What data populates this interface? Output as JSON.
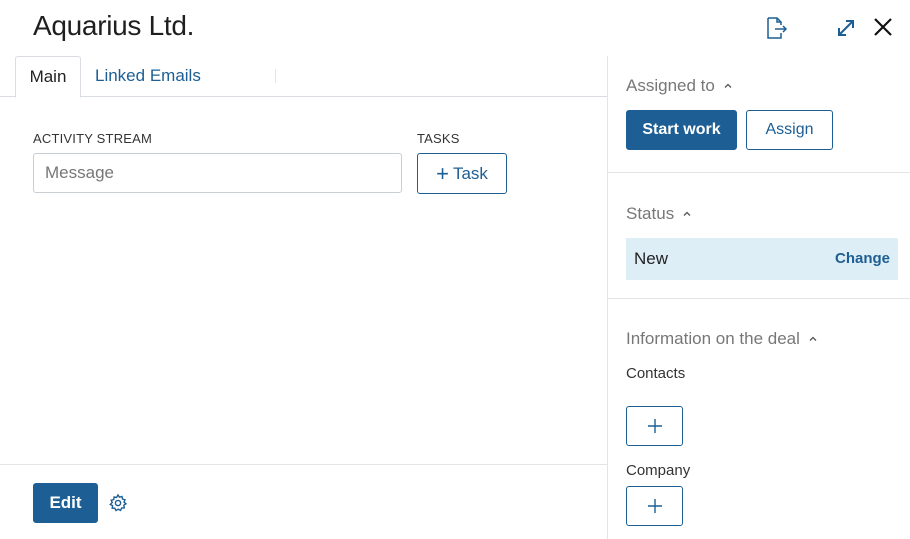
{
  "header": {
    "title": "Aquarius Ltd.",
    "icons": [
      "export-icon",
      "expand-icon",
      "close-icon"
    ]
  },
  "tabs": [
    {
      "label": "Main",
      "active": true
    },
    {
      "label": "Linked Emails",
      "active": false
    }
  ],
  "activity": {
    "label": "ACTIVITY STREAM",
    "placeholder": "Message"
  },
  "tasks": {
    "label": "TASKS",
    "button_label": "Task"
  },
  "footer": {
    "edit_label": "Edit"
  },
  "assigned": {
    "title": "Assigned to",
    "start_label": "Start work",
    "assign_label": "Assign"
  },
  "status": {
    "title": "Status",
    "value": "New",
    "change_label": "Change"
  },
  "deal_info": {
    "title": "Information on the deal",
    "contacts_label": "Contacts",
    "company_label": "Company"
  },
  "colors": {
    "accent": "#1d5f94",
    "status_bg": "#deeef7",
    "divider": "#e2e5e8"
  }
}
